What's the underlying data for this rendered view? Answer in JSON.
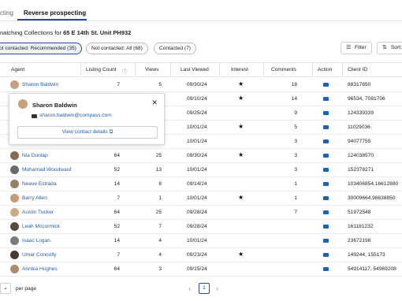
{
  "tabs": [
    {
      "label": "cting"
    },
    {
      "label": "Reverse prospecting"
    }
  ],
  "heading": {
    "prefix": "natching Collections for",
    "property": "65 E 14th St. Unit PH932"
  },
  "filters": [
    {
      "label": "ot contacted: Recommended (35)",
      "active": true
    },
    {
      "label": "Not contacted: All (68)",
      "active": false
    },
    {
      "label": "Contacted (7)",
      "active": false
    }
  ],
  "toolbar": {
    "filter_label": "Filter",
    "sort_label": "Sort:"
  },
  "columns": {
    "agent": "Agent",
    "listing_count": "Listing Count",
    "views": "Views",
    "last_viewed": "Last Viewed",
    "interest": "Interest",
    "comments": "Comments",
    "action": "Action",
    "client_id": "Client ID"
  },
  "rows": [
    {
      "agent": "Sharon Baldwin",
      "listing_count": "7",
      "views": "5",
      "last_viewed": "09/30/24",
      "starred": true,
      "comments": "18",
      "client_id": "88317650",
      "avatar_color": "#c8a07c"
    },
    {
      "agent": "",
      "listing_count": "",
      "views": "",
      "last_viewed": "09/10/24",
      "starred": true,
      "comments": "14",
      "client_id": "96534, 7081706",
      "avatar_color": ""
    },
    {
      "agent": "",
      "listing_count": "",
      "views": "",
      "last_viewed": "09/25/24",
      "starred": false,
      "comments": "9",
      "client_id": "124339339",
      "avatar_color": ""
    },
    {
      "agent": "",
      "listing_count": "",
      "views": "",
      "last_viewed": "10/01/24",
      "starred": true,
      "comments": "5",
      "client_id": "11029036",
      "avatar_color": ""
    },
    {
      "agent": "",
      "listing_count": "",
      "views": "",
      "last_viewed": "10/01/24",
      "starred": false,
      "comments": "3",
      "client_id": "94077755",
      "avatar_color": ""
    },
    {
      "agent": "Nia Dunlap",
      "listing_count": "64",
      "views": "25",
      "last_viewed": "09/30/24",
      "starred": true,
      "comments": "3",
      "client_id": "124038570",
      "avatar_color": "#8a6a4f"
    },
    {
      "agent": "Mohamad Woodward",
      "listing_count": "52",
      "views": "13",
      "last_viewed": "10/01/24",
      "starred": false,
      "comments": "3",
      "client_id": "152378271",
      "avatar_color": "#6b6b6b"
    },
    {
      "agent": "Neave Estrada",
      "listing_count": "14",
      "views": "8",
      "last_viewed": "09/14/24",
      "starred": false,
      "comments": "1",
      "client_id": "103406854,16612880",
      "avatar_color": "#9a7d66"
    },
    {
      "agent": "Barry Allen",
      "listing_count": "7",
      "views": "1",
      "last_viewed": "10/01/24",
      "starred": true,
      "comments": "1",
      "client_id": "30009664,98638850",
      "avatar_color": "#c79a73"
    },
    {
      "agent": "Austin Tucker",
      "listing_count": "64",
      "views": "25",
      "last_viewed": "09/28/24",
      "starred": false,
      "comments": "7",
      "client_id": "51972548",
      "avatar_color": "#d0a980"
    },
    {
      "agent": "Leah Mccormick",
      "listing_count": "52",
      "views": "7",
      "last_viewed": "09/28/24",
      "starred": false,
      "comments": "",
      "client_id": "161181232",
      "avatar_color": "#5a4a3e"
    },
    {
      "agent": "Isaac Logan",
      "listing_count": "14",
      "views": "4",
      "last_viewed": "10/01/24",
      "starred": false,
      "comments": "",
      "client_id": "23672198",
      "avatar_color": "#7a7a7a"
    },
    {
      "agent": "Umar Connolly",
      "listing_count": "7",
      "views": "4",
      "last_viewed": "09/23/24",
      "starred": true,
      "comments": "",
      "client_id": "149244, 155173",
      "avatar_color": "#4e3b30"
    },
    {
      "agent": "Annika Hughes",
      "listing_count": "64",
      "views": "3",
      "last_viewed": "09/15/24",
      "starred": false,
      "comments": "",
      "client_id": "54914117, 54969208",
      "avatar_color": "#b08a6a"
    }
  ],
  "popup": {
    "name": "Sharon Baldwin",
    "email": "sharon.baldwin@compass.com",
    "button_label": "View contact details"
  },
  "footer": {
    "per_page_label": "per page",
    "current_page": "1"
  }
}
